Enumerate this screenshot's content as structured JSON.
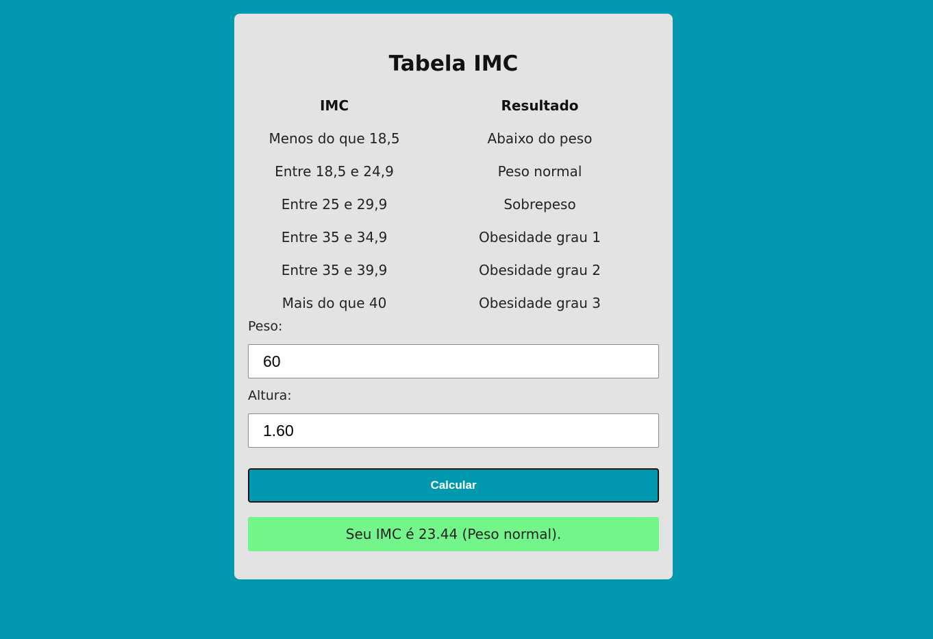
{
  "title": "Tabela IMC",
  "table": {
    "headers": [
      "IMC",
      "Resultado"
    ],
    "rows": [
      [
        "Menos do que 18,5",
        "Abaixo do peso"
      ],
      [
        "Entre 18,5 e 24,9",
        "Peso normal"
      ],
      [
        "Entre 25 e 29,9",
        "Sobrepeso"
      ],
      [
        "Entre 35 e 34,9",
        "Obesidade grau 1"
      ],
      [
        "Entre 35 e 39,9",
        "Obesidade grau 2"
      ],
      [
        "Mais do que 40",
        "Obesidade grau 3"
      ]
    ]
  },
  "form": {
    "peso_label": "Peso:",
    "peso_value": "60",
    "altura_label": "Altura:",
    "altura_value": "1.60",
    "button_label": "Calcular"
  },
  "result": {
    "text": "Seu IMC é 23.44 (Peso normal)."
  },
  "colors": {
    "background": "#0099b0",
    "card": "#e3e3e3",
    "button": "#0099b0",
    "result_ok": "#73f58c"
  }
}
